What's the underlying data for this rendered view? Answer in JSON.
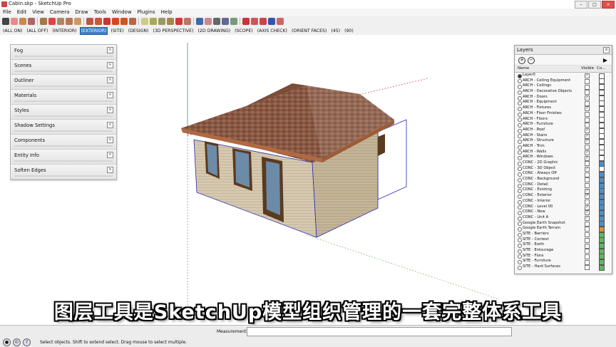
{
  "window": {
    "title": "Cabin.skp - SketchUp Pro"
  },
  "menu": [
    "File",
    "Edit",
    "View",
    "Camera",
    "Draw",
    "Tools",
    "Window",
    "Plugins",
    "Help"
  ],
  "toolbar_icons": [
    {
      "name": "select-icon",
      "color": "#444"
    },
    {
      "name": "eraser-icon",
      "color": "#e88"
    },
    {
      "name": "paint-bucket-icon",
      "color": "#c84"
    },
    {
      "name": "make-component-icon",
      "color": "#a66"
    },
    {
      "name": "rectangle-icon",
      "color": "#a8744a"
    },
    {
      "name": "line-icon",
      "color": "#d44"
    },
    {
      "name": "circle-icon",
      "color": "#a86"
    },
    {
      "name": "arc-icon",
      "color": "#b75"
    },
    {
      "name": "polygon-icon",
      "color": "#c96"
    },
    {
      "name": "push-pull-icon",
      "color": "#b54"
    },
    {
      "name": "follow-me-icon",
      "color": "#c53"
    },
    {
      "name": "move-icon",
      "color": "#c33"
    },
    {
      "name": "rotate-icon",
      "color": "#d42"
    },
    {
      "name": "scale-icon",
      "color": "#c52"
    },
    {
      "name": "offset-icon",
      "color": "#b64"
    },
    {
      "name": "tape-measure-icon",
      "color": "#cc8"
    },
    {
      "name": "dimension-icon",
      "color": "#aa5"
    },
    {
      "name": "protractor-icon",
      "color": "#996"
    },
    {
      "name": "text-icon",
      "color": "#a84"
    },
    {
      "name": "axes-icon",
      "color": "#d33"
    },
    {
      "name": "3d-text-icon",
      "color": "#b76"
    },
    {
      "name": "orbit-icon",
      "color": "#46a"
    },
    {
      "name": "pan-icon",
      "color": "#c88"
    },
    {
      "name": "zoom-icon",
      "color": "#666"
    },
    {
      "name": "zoom-window-icon",
      "color": "#669"
    },
    {
      "name": "zoom-extents-icon",
      "color": "#797"
    },
    {
      "name": "get-models-icon",
      "color": "#c33"
    },
    {
      "name": "share-model-icon",
      "color": "#c55"
    },
    {
      "name": "extension-warehouse-icon",
      "color": "#c44"
    },
    {
      "name": "google-earth-icon",
      "color": "#35a"
    },
    {
      "name": "layout-icon",
      "color": "#c66"
    }
  ],
  "scenes": [
    "(ALL ON)",
    "(ALL OFF)",
    "(INTERIOR)",
    "(EXTERIOR)",
    "(SITE)",
    "(DESIGN)",
    "(3D PERSPECTIVE)",
    "(2D DRAWING)",
    "(SCOPE)",
    "(AXIS CHECK)",
    "(ORIENT FACES)",
    "(45)",
    "(90)"
  ],
  "active_scene": "(EXTERIOR)",
  "tray_panels": [
    "Fog",
    "Scenes",
    "Outliner",
    "Materials",
    "Styles",
    "Shadow Settings",
    "Components",
    "Entity Info",
    "Soften Edges"
  ],
  "layers_panel": {
    "title": "Layers",
    "col_name": "Name",
    "col_visible": "Visible",
    "col_color": "Co...",
    "rows": [
      {
        "name": "Layer0",
        "active": true,
        "visible": true,
        "color": "#ffffff"
      },
      {
        "name": "ARCH - Ceiling Equipment",
        "active": false,
        "visible": false,
        "color": "#ffffff"
      },
      {
        "name": "ARCH - Ceilings",
        "active": false,
        "visible": false,
        "color": "#ffffff"
      },
      {
        "name": "ARCH - Decorative Objects",
        "active": false,
        "visible": false,
        "color": "#ffffff"
      },
      {
        "name": "ARCH - Doors",
        "active": false,
        "visible": true,
        "color": "#ffffff"
      },
      {
        "name": "ARCH - Equipment",
        "active": false,
        "visible": false,
        "color": "#ffffff"
      },
      {
        "name": "ARCH - Fixtures",
        "active": false,
        "visible": true,
        "color": "#ffffff"
      },
      {
        "name": "ARCH - Floor Finishes",
        "active": false,
        "visible": false,
        "color": "#ffffff"
      },
      {
        "name": "ARCH - Floors",
        "active": false,
        "visible": false,
        "color": "#ffffff"
      },
      {
        "name": "ARCH - Furniture",
        "active": false,
        "visible": false,
        "color": "#ffffff"
      },
      {
        "name": "ARCH - Roof",
        "active": false,
        "visible": true,
        "color": "#ffffff"
      },
      {
        "name": "ARCH - Stairs",
        "active": false,
        "visible": true,
        "color": "#ffffff"
      },
      {
        "name": "ARCH - Structure",
        "active": false,
        "visible": true,
        "color": "#ffffff"
      },
      {
        "name": "ARCH - Trim",
        "active": false,
        "visible": false,
        "color": "#ffffff"
      },
      {
        "name": "ARCH - Walls",
        "active": false,
        "visible": true,
        "color": "#ffffff"
      },
      {
        "name": "ARCH - Windows",
        "active": false,
        "visible": true,
        "color": "#ffffff"
      },
      {
        "name": "CONC - 2D Graphic",
        "active": false,
        "visible": false,
        "color": "#4a90c8"
      },
      {
        "name": "CONC - 3D Object",
        "active": false,
        "visible": true,
        "color": "#ffffff"
      },
      {
        "name": "CONC - Always Off",
        "active": false,
        "visible": false,
        "color": "#4a90c8"
      },
      {
        "name": "CONC - Background",
        "active": false,
        "visible": false,
        "color": "#4a90c8"
      },
      {
        "name": "CONC - Detail",
        "active": false,
        "visible": false,
        "color": "#4a90c8"
      },
      {
        "name": "CONC - Existing",
        "active": false,
        "visible": true,
        "color": "#4a90c8"
      },
      {
        "name": "CONC - Exterior",
        "active": false,
        "visible": true,
        "color": "#4a90c8"
      },
      {
        "name": "CONC - Interior",
        "active": false,
        "visible": false,
        "color": "#4a90c8"
      },
      {
        "name": "CONC - Level 00",
        "active": false,
        "visible": true,
        "color": "#4a90c8"
      },
      {
        "name": "CONC - New",
        "active": false,
        "visible": true,
        "color": "#4a90c8"
      },
      {
        "name": "CONC - Unit A",
        "active": false,
        "visible": true,
        "color": "#4a90c8"
      },
      {
        "name": "Google Earth Snapshot",
        "active": false,
        "visible": false,
        "color": "#4a90c8"
      },
      {
        "name": "Google Earth Terrain",
        "active": false,
        "visible": false,
        "color": "#e88a2a"
      },
      {
        "name": "SITE - Barriers",
        "active": false,
        "visible": false,
        "color": "#5cb85c"
      },
      {
        "name": "SITE - Context",
        "active": false,
        "visible": false,
        "color": "#5cb85c"
      },
      {
        "name": "SITE - Earth",
        "active": false,
        "visible": false,
        "color": "#5cb85c"
      },
      {
        "name": "SITE - Entourage",
        "active": false,
        "visible": false,
        "color": "#5cb85c"
      },
      {
        "name": "SITE - Flora",
        "active": false,
        "visible": false,
        "color": "#5cb85c"
      },
      {
        "name": "SITE - Furniture",
        "active": false,
        "visible": false,
        "color": "#5cb85c"
      },
      {
        "name": "SITE - Hard Surfaces",
        "active": false,
        "visible": false,
        "color": "#5cb85c"
      }
    ]
  },
  "subtitle": "图层工具是SketchUp模型组织管理的一套完整体系工具",
  "status": {
    "measurements_label": "Measurements",
    "measurements_value": "",
    "hint": "Select objects. Shift to extend select. Drag mouse to select multiple."
  },
  "accent_color": "#3d7cc9"
}
